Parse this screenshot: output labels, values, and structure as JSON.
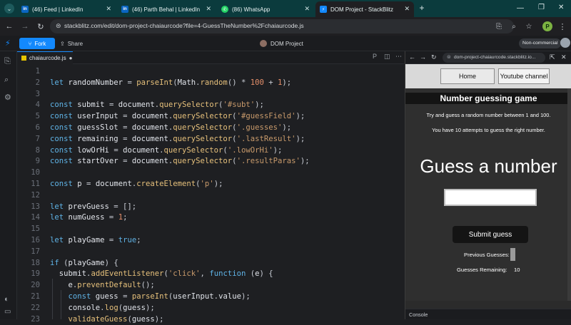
{
  "browser": {
    "tabs": [
      {
        "title": "(46) Feed | LinkedIn",
        "icon": "linkedin-icon",
        "active": false
      },
      {
        "title": "(46) Parth Behal | LinkedIn",
        "icon": "linkedin-icon",
        "active": false
      },
      {
        "title": "(86) WhatsApp",
        "icon": "whatsapp-icon",
        "active": false
      },
      {
        "title": "DOM Project - StackBlitz",
        "icon": "stackblitz-icon",
        "active": true
      }
    ],
    "new_tab_label": "+",
    "url": "stackblitz.com/edit/dom-project-chaiaurcode?file=4-GuessTheNumber%2Fchaiaurcode.js",
    "profile_initial": "P"
  },
  "stackblitz": {
    "fork_label": "Fork",
    "share_label": "Share",
    "project_title": "DOM Project",
    "plan_badge": "Non-commercial"
  },
  "editor": {
    "active_file": "chaiaurcode.js",
    "lines": [
      {
        "n": "1",
        "tokens": []
      },
      {
        "n": "2",
        "tokens": [
          [
            "kw",
            "let "
          ],
          [
            "var",
            "randomNumber "
          ],
          [
            "op",
            "= "
          ],
          [
            "fn",
            "parseInt"
          ],
          [
            "op",
            "("
          ],
          [
            "var",
            "Math"
          ],
          [
            "op",
            "."
          ],
          [
            "fn",
            "random"
          ],
          [
            "op",
            "() * "
          ],
          [
            "num",
            "100"
          ],
          [
            "op",
            " + "
          ],
          [
            "num",
            "1"
          ],
          [
            "op",
            ");"
          ]
        ]
      },
      {
        "n": "3",
        "tokens": []
      },
      {
        "n": "4",
        "tokens": [
          [
            "kw",
            "const "
          ],
          [
            "var",
            "submit "
          ],
          [
            "op",
            "= "
          ],
          [
            "var",
            "document"
          ],
          [
            "op",
            "."
          ],
          [
            "fn",
            "querySelector"
          ],
          [
            "op",
            "("
          ],
          [
            "str",
            "'#subt'"
          ],
          [
            "op",
            ");"
          ]
        ]
      },
      {
        "n": "5",
        "tokens": [
          [
            "kw",
            "const "
          ],
          [
            "var",
            "userInput "
          ],
          [
            "op",
            "= "
          ],
          [
            "var",
            "document"
          ],
          [
            "op",
            "."
          ],
          [
            "fn",
            "querySelector"
          ],
          [
            "op",
            "("
          ],
          [
            "str",
            "'#guessField'"
          ],
          [
            "op",
            ");"
          ]
        ]
      },
      {
        "n": "6",
        "tokens": [
          [
            "kw",
            "const "
          ],
          [
            "var",
            "guessSlot "
          ],
          [
            "op",
            "= "
          ],
          [
            "var",
            "document"
          ],
          [
            "op",
            "."
          ],
          [
            "fn",
            "querySelector"
          ],
          [
            "op",
            "("
          ],
          [
            "str",
            "'.guesses'"
          ],
          [
            "op",
            ");"
          ]
        ]
      },
      {
        "n": "7",
        "tokens": [
          [
            "kw",
            "const "
          ],
          [
            "var",
            "remaining "
          ],
          [
            "op",
            "= "
          ],
          [
            "var",
            "document"
          ],
          [
            "op",
            "."
          ],
          [
            "fn",
            "querySelector"
          ],
          [
            "op",
            "("
          ],
          [
            "str",
            "'.lastResult'"
          ],
          [
            "op",
            ");"
          ]
        ]
      },
      {
        "n": "8",
        "tokens": [
          [
            "kw",
            "const "
          ],
          [
            "var",
            "lowOrHi "
          ],
          [
            "op",
            "= "
          ],
          [
            "var",
            "document"
          ],
          [
            "op",
            "."
          ],
          [
            "fn",
            "querySelector"
          ],
          [
            "op",
            "("
          ],
          [
            "str",
            "'.lowOrHi'"
          ],
          [
            "op",
            ");"
          ]
        ]
      },
      {
        "n": "9",
        "tokens": [
          [
            "kw",
            "const "
          ],
          [
            "var",
            "startOver "
          ],
          [
            "op",
            "= "
          ],
          [
            "var",
            "document"
          ],
          [
            "op",
            "."
          ],
          [
            "fn",
            "querySelector"
          ],
          [
            "op",
            "("
          ],
          [
            "str",
            "'.resultParas'"
          ],
          [
            "op",
            ");"
          ]
        ]
      },
      {
        "n": "10",
        "tokens": []
      },
      {
        "n": "11",
        "tokens": [
          [
            "kw",
            "const "
          ],
          [
            "var",
            "p "
          ],
          [
            "op",
            "= "
          ],
          [
            "var",
            "document"
          ],
          [
            "op",
            "."
          ],
          [
            "fn",
            "createElement"
          ],
          [
            "op",
            "("
          ],
          [
            "str",
            "'p'"
          ],
          [
            "op",
            ");"
          ]
        ]
      },
      {
        "n": "12",
        "tokens": []
      },
      {
        "n": "13",
        "tokens": [
          [
            "kw",
            "let "
          ],
          [
            "var",
            "prevGuess "
          ],
          [
            "op",
            "= [];"
          ]
        ]
      },
      {
        "n": "14",
        "tokens": [
          [
            "kw",
            "let "
          ],
          [
            "var",
            "numGuess "
          ],
          [
            "op",
            "= "
          ],
          [
            "num",
            "1"
          ],
          [
            "op",
            ";"
          ]
        ]
      },
      {
        "n": "15",
        "tokens": []
      },
      {
        "n": "16",
        "tokens": [
          [
            "kw",
            "let "
          ],
          [
            "var",
            "playGame "
          ],
          [
            "op",
            "= "
          ],
          [
            "kw",
            "true"
          ],
          [
            "op",
            ";"
          ]
        ]
      },
      {
        "n": "17",
        "tokens": []
      },
      {
        "n": "18",
        "tokens": [
          [
            "kw",
            "if "
          ],
          [
            "op",
            "("
          ],
          [
            "var",
            "playGame"
          ],
          [
            "op",
            ") {"
          ]
        ]
      },
      {
        "n": "19",
        "tokens": [
          [
            "op",
            "  "
          ],
          [
            "var",
            "submit"
          ],
          [
            "op",
            "."
          ],
          [
            "fn",
            "addEventListener"
          ],
          [
            "op",
            "("
          ],
          [
            "str",
            "'click'"
          ],
          [
            "op",
            ", "
          ],
          [
            "kw",
            "function "
          ],
          [
            "op",
            "("
          ],
          [
            "var",
            "e"
          ],
          [
            "op",
            ") {"
          ]
        ]
      },
      {
        "n": "20",
        "tokens": [
          [
            "op",
            "    "
          ],
          [
            "var",
            "e"
          ],
          [
            "op",
            "."
          ],
          [
            "fn",
            "preventDefault"
          ],
          [
            "op",
            "();"
          ]
        ]
      },
      {
        "n": "21",
        "tokens": [
          [
            "op",
            "    "
          ],
          [
            "kw",
            "const "
          ],
          [
            "var",
            "guess "
          ],
          [
            "op",
            "= "
          ],
          [
            "fn",
            "parseInt"
          ],
          [
            "op",
            "("
          ],
          [
            "var",
            "userInput"
          ],
          [
            "op",
            "."
          ],
          [
            "var",
            "value"
          ],
          [
            "op",
            ");"
          ]
        ]
      },
      {
        "n": "22",
        "tokens": [
          [
            "op",
            "    "
          ],
          [
            "var",
            "console"
          ],
          [
            "op",
            "."
          ],
          [
            "fn",
            "log"
          ],
          [
            "op",
            "("
          ],
          [
            "var",
            "guess"
          ],
          [
            "op",
            ");"
          ]
        ]
      },
      {
        "n": "23",
        "tokens": [
          [
            "op",
            "    "
          ],
          [
            "fn",
            "validateGuess"
          ],
          [
            "op",
            "("
          ],
          [
            "var",
            "guess"
          ],
          [
            "op",
            ");"
          ]
        ]
      }
    ]
  },
  "preview": {
    "url": "dom-project-chaiaurcode.stackblitz.io...",
    "home_label": "Home",
    "youtube_label": "Youtube channel",
    "heading": "Number guessing game",
    "intro1": "Try and guess a random number between 1 and 100.",
    "intro2": "You have 10 attempts to guess the right number.",
    "big_title": "Guess a number",
    "submit_label": "Submit guess",
    "prev_label": "Previous Guesses:",
    "remaining_label": "Guesses Remaining:",
    "remaining_value": "10",
    "console_label": "Console"
  },
  "colors": {
    "tabstrip": "#0b3b3d",
    "fork_button": "#1389fd",
    "keyword": "#5fb3e6",
    "function": "#e6c07b",
    "string": "#c89a6b"
  }
}
